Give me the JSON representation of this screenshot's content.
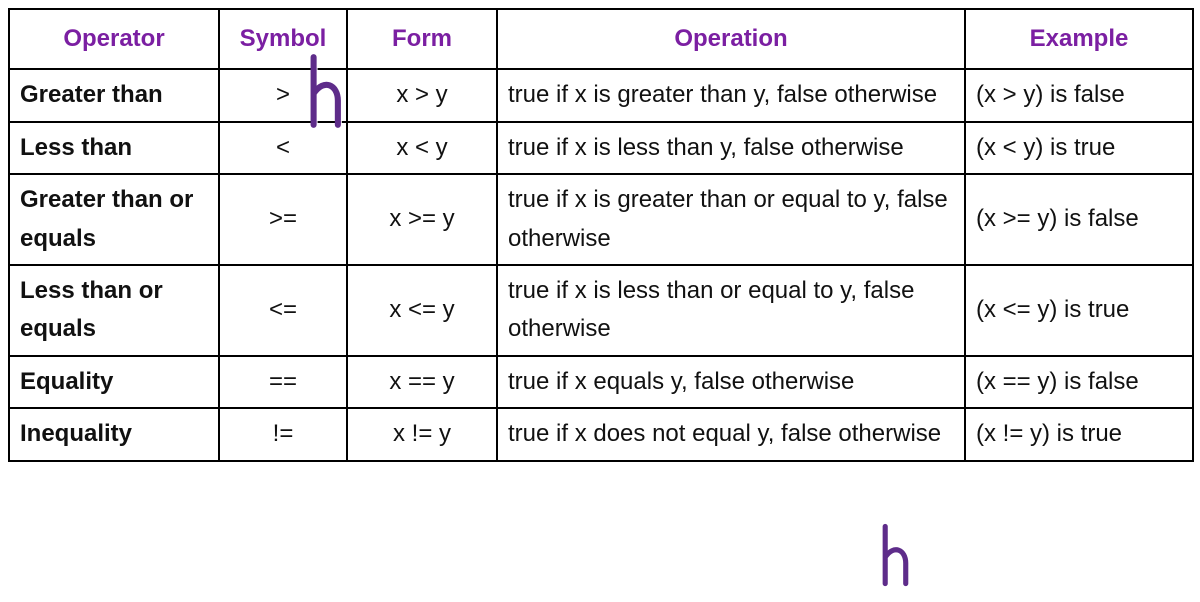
{
  "chart_data": {
    "type": "table",
    "title": "",
    "headers": [
      "Operator",
      "Symbol",
      "Form",
      "Operation",
      "Example"
    ],
    "rows": [
      {
        "operator": "Greater than",
        "symbol": ">",
        "form": "x > y",
        "operation": "true if x is greater than y, false otherwise",
        "example": "(x > y) is false"
      },
      {
        "operator": "Less than",
        "symbol": "<",
        "form": "x < y",
        "operation": "true if x is less than y, false otherwise",
        "example": "(x < y) is true"
      },
      {
        "operator": "Greater than or equals",
        "symbol": ">=",
        "form": "x >= y",
        "operation": "true if x is greater than or equal to y, false otherwise",
        "example": "(x >= y) is false"
      },
      {
        "operator": "Less than or equals",
        "symbol": "<=",
        "form": "x <= y",
        "operation": "true if x is less than or equal to y, false otherwise",
        "example": "(x <= y) is true"
      },
      {
        "operator": "Equality",
        "symbol": "==",
        "form": "x == y",
        "operation": "true if x equals y, false otherwise",
        "example": "(x == y) is false"
      },
      {
        "operator": "Inequality",
        "symbol": "!=",
        "form": "x != y",
        "operation": "true if x does not equal y, false otherwise",
        "example": "(x != y) is true"
      }
    ]
  },
  "colors": {
    "header_text": "#7B1FA2",
    "border": "#000000",
    "watermark_stroke": "#5E2C8A"
  }
}
